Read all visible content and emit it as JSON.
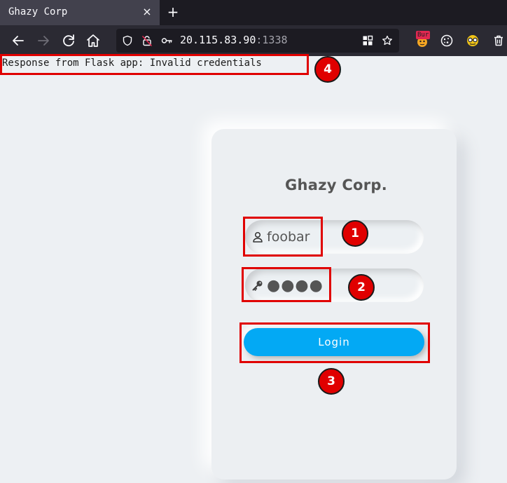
{
  "browser": {
    "tab": {
      "title": "Ghazy Corp",
      "close_glyph": "×"
    },
    "new_tab_glyph": "+",
    "url": {
      "host": "20.115.83.90",
      "port": ":1338"
    },
    "extension_badge": "Bur",
    "icons": [
      "back-arrow-icon",
      "forward-arrow-icon",
      "reload-icon",
      "home-icon",
      "shield-icon",
      "lock-slash-icon",
      "key-icon",
      "qr-grid-icon",
      "star-icon",
      "burp-extension-icon",
      "cookie-icon",
      "spy-glasses-icon",
      "trash-icon"
    ]
  },
  "response_text": "Response from Flask app: Invalid credentials",
  "login": {
    "brand": "Ghazy Corp.",
    "username_value": "foobar",
    "password_value": "●●●●",
    "button_label": "Login"
  },
  "annotations": {
    "markers": [
      "1",
      "2",
      "3",
      "4"
    ],
    "color": "#e00000"
  },
  "colors": {
    "button_blue": "#03a9f4",
    "page_bg": "#edf0f3",
    "toolbar_bg": "#2b2a33",
    "tabstrip_bg": "#1c1b22"
  }
}
